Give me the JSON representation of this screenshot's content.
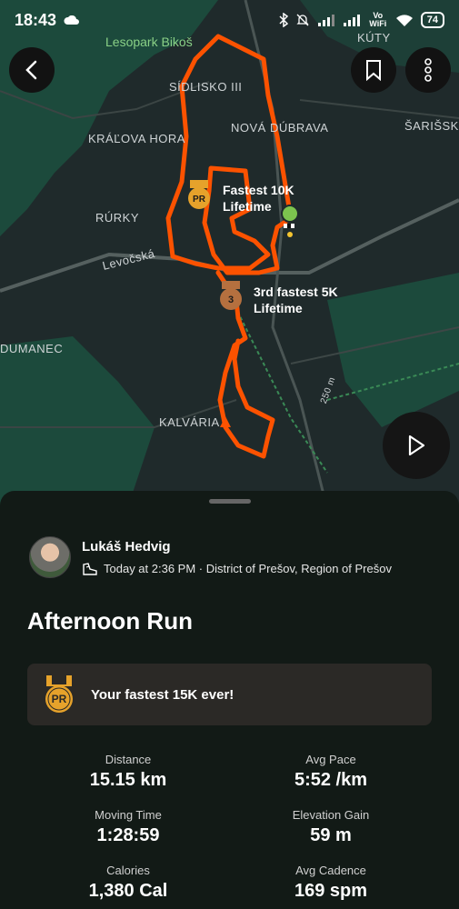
{
  "status_bar": {
    "time": "18:43",
    "battery": "74",
    "network": "Vo WiFi"
  },
  "map": {
    "labels": {
      "top_right": "KÚTY",
      "park": "Lesopark Bikoš",
      "sidlisko": "SÍDLISKO III",
      "nova_dubrava": "NOVÁ DÚBRAVA",
      "sariss": "ŠARIŠSK",
      "kralova_hora": "KRÁĽOVA HORA",
      "rurky": "RÚRKY",
      "levocska": "Levočská",
      "dumanec": "DUMANEC",
      "kalvaria": "KALVÁRIA",
      "road": "250 m"
    },
    "callouts": {
      "fastest_10k": "Fastest 10K\nLifetime",
      "third_5k": "3rd fastest 5K\nLifetime"
    },
    "badges": {
      "pr": "PR",
      "third": "3"
    }
  },
  "activity": {
    "athlete_name": "Lukáš Hedvig",
    "meta": "Today at 2:36 PM · District of Prešov, Region of Prešov",
    "title": "Afternoon Run",
    "achievement": "Your fastest 15K ever!",
    "achievement_badge": "PR",
    "stats": [
      {
        "label": "Distance",
        "value": "15.15 km"
      },
      {
        "label": "Avg Pace",
        "value": "5:52 /km"
      },
      {
        "label": "Moving Time",
        "value": "1:28:59"
      },
      {
        "label": "Elevation Gain",
        "value": "59 m"
      },
      {
        "label": "Calories",
        "value": "1,380 Cal"
      },
      {
        "label": "Avg Cadence",
        "value": "169 spm"
      }
    ]
  },
  "colors": {
    "route": "#fc5200",
    "pr_gold": "#e6a22b",
    "bronze": "#b5703f",
    "start_green": "#7cc44e"
  }
}
